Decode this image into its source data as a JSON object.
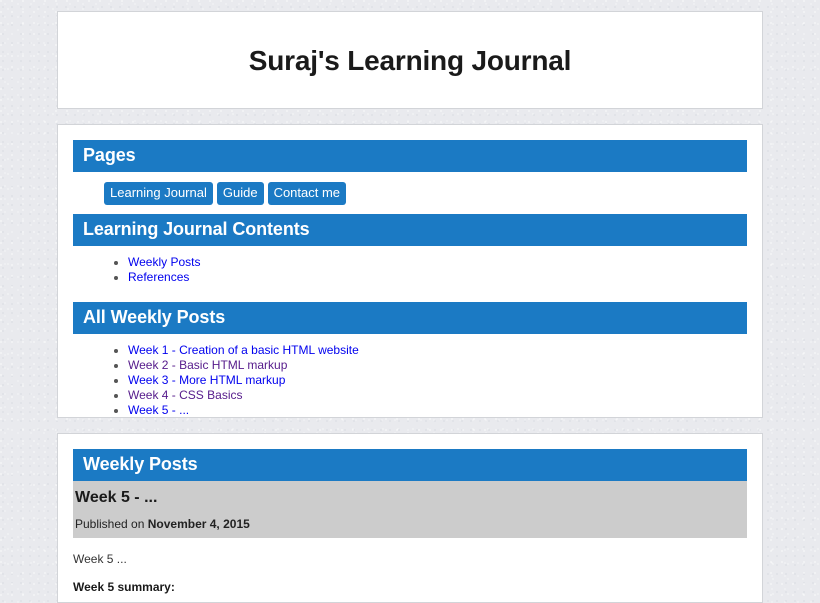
{
  "site": {
    "title": "Suraj's Learning Journal"
  },
  "pages_section": {
    "header": "Pages",
    "buttons": [
      {
        "label": "Learning Journal"
      },
      {
        "label": "Guide"
      },
      {
        "label": "Contact me"
      }
    ]
  },
  "contents_section": {
    "header": "Learning Journal Contents",
    "links": [
      {
        "label": "Weekly Posts",
        "visited": false
      },
      {
        "label": "References",
        "visited": false
      }
    ]
  },
  "all_posts_section": {
    "header": "All Weekly Posts",
    "links": [
      {
        "label": "Week 1 - Creation of a basic HTML website",
        "visited": false
      },
      {
        "label": "Week 2 - Basic HTML markup",
        "visited": true
      },
      {
        "label": "Week 3 - More HTML markup",
        "visited": false
      },
      {
        "label": "Week 4 - CSS Basics",
        "visited": true
      },
      {
        "label": "Week 5 - ...",
        "visited": false
      }
    ]
  },
  "weekly_posts_section": {
    "header": "Weekly Posts",
    "post": {
      "title": "Week 5 - ...",
      "published_prefix": "Published on",
      "published_date": "November 4, 2015",
      "body_line": "Week 5 ...",
      "summary_heading": "Week 5 summary:"
    }
  },
  "colors": {
    "accent_blue": "#1b7ac4",
    "link_blue": "#0000ee",
    "link_visited_purple": "#551a8b",
    "post_header_gray": "#cccccc",
    "page_background": "#e9eaee",
    "panel_border": "#d2d4d8"
  }
}
